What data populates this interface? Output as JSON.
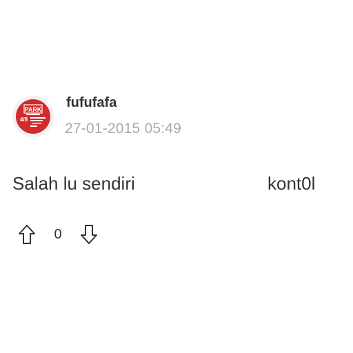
{
  "post": {
    "author": {
      "username": "fufufafa",
      "avatar_icon": "avatar-logo-icon",
      "avatar_logo_text": "PARK",
      "avatar_badge_text": "4/8"
    },
    "timestamp": "27-01-2015 05:49",
    "content": {
      "left_text": "Salah lu sendiri",
      "right_text": "kont0l"
    },
    "votes": {
      "upvote_icon": "arrow-up-icon",
      "count": "0",
      "downvote_icon": "arrow-down-icon"
    }
  },
  "colors": {
    "text": "#333333",
    "muted": "#a8a8a8",
    "avatar_red": "#d22b2b",
    "background": "#ffffff"
  }
}
